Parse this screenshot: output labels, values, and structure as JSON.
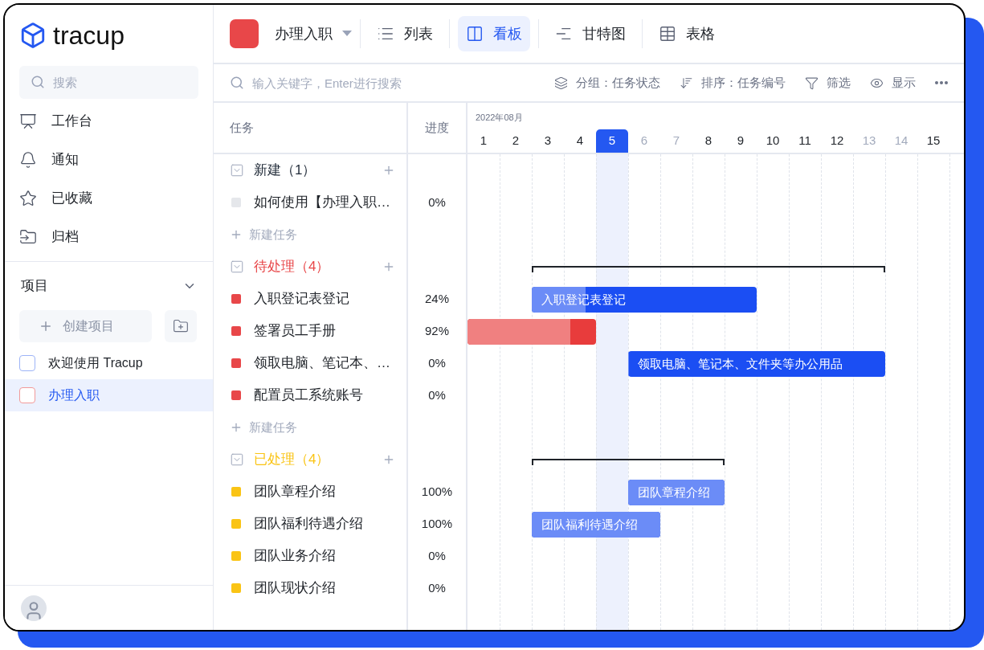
{
  "brand": {
    "name": "tracup"
  },
  "sidebar": {
    "search": {
      "placeholder": "搜索"
    },
    "nav": [
      {
        "label": "工作台"
      },
      {
        "label": "通知"
      },
      {
        "label": "已收藏"
      },
      {
        "label": "归档"
      }
    ],
    "projects_section": {
      "title": "项目",
      "expanded": true,
      "create_label": "创建项目"
    },
    "projects": [
      {
        "name": "欢迎使用 Tracup",
        "color": "#9db4f7",
        "selected": false
      },
      {
        "name": "办理入职",
        "color": "#f29a9a",
        "selected": true
      }
    ]
  },
  "toolbar": {
    "project": {
      "name": "办理入职",
      "color": "#e84749"
    },
    "views": [
      {
        "label": "列表",
        "selected": false
      },
      {
        "label": "看板",
        "selected": true
      },
      {
        "label": "甘特图",
        "selected": false
      },
      {
        "label": "表格",
        "selected": false
      }
    ]
  },
  "filter_bar": {
    "search": {
      "placeholder": "输入关键字，Enter进行搜索"
    },
    "actions": [
      {
        "label": "分组：任务状态"
      },
      {
        "label": "排序：任务编号"
      },
      {
        "label": "筛选"
      },
      {
        "label": "显示"
      }
    ]
  },
  "gantt": {
    "columns": [
      {
        "label": "任务"
      },
      {
        "label": "进度"
      }
    ],
    "month": "2022年08月",
    "days": [
      {
        "label": "1",
        "today": false,
        "weekend": false
      },
      {
        "label": "2",
        "today": false,
        "weekend": false
      },
      {
        "label": "3",
        "today": false,
        "weekend": false
      },
      {
        "label": "4",
        "today": false,
        "weekend": false
      },
      {
        "label": "5",
        "today": true,
        "weekend": false
      },
      {
        "label": "6",
        "today": false,
        "weekend": true
      },
      {
        "label": "7",
        "today": false,
        "weekend": true
      },
      {
        "label": "8",
        "today": false,
        "weekend": false
      },
      {
        "label": "9",
        "today": false,
        "weekend": false
      },
      {
        "label": "10",
        "today": false,
        "weekend": false
      },
      {
        "label": "11",
        "today": false,
        "weekend": false
      },
      {
        "label": "12",
        "today": false,
        "weekend": false
      },
      {
        "label": "13",
        "today": false,
        "weekend": true
      },
      {
        "label": "14",
        "today": false,
        "weekend": true
      },
      {
        "label": "15",
        "today": false,
        "weekend": false
      }
    ],
    "groups": [
      {
        "title": "新建（1）",
        "color": "#1f2937",
        "expanded": true,
        "new_task_label": "新建任务",
        "tasks": [
          {
            "name": "如何使用【办理入职…",
            "color": "#e5e7eb",
            "progress": "0%"
          }
        ]
      },
      {
        "title": "待处理（4）",
        "color": "#e84749",
        "expanded": true,
        "span_bracket": true,
        "new_task_label": "新建任务",
        "tasks": [
          {
            "name": "入职登记表登记",
            "color": "#e84749",
            "progress": "24%",
            "level": 0.24,
            "bar": {
              "color": "#6b8cf7",
              "label": "入职登记表登记"
            }
          },
          {
            "name": "签署员工手册",
            "color": "#e84749",
            "progress": "92%",
            "level": 0.8,
            "bar": {
              "color": "#f08080"
            }
          },
          {
            "name": "领取电脑、笔记本、…",
            "color": "#e84749",
            "progress": "0%",
            "level": 0,
            "bar": {
              "color": "#6b8cf7",
              "label": "领取电脑、笔记本、文件夹等办公用品"
            }
          },
          {
            "name": "配置员工系统账号",
            "color": "#e84749",
            "progress": "0%"
          }
        ]
      },
      {
        "title": "已处理（4）",
        "color": "#fac415",
        "expanded": true,
        "span_bracket": true,
        "tasks": [
          {
            "name": "团队章程介绍",
            "color": "#fac415",
            "progress": "100%",
            "level": 1,
            "bar": {
              "color": "#6b8cf7",
              "label": "团队章程介绍"
            }
          },
          {
            "name": "团队福利待遇介绍",
            "color": "#fac415",
            "progress": "100%",
            "level": 1,
            "bar": {
              "color": "#6b8cf7",
              "label": "团队福利待遇介绍"
            }
          },
          {
            "name": "团队业务介绍",
            "color": "#fac415",
            "progress": "0%"
          },
          {
            "name": "团队现状介绍",
            "color": "#fac415",
            "progress": "0%"
          }
        ]
      }
    ]
  }
}
